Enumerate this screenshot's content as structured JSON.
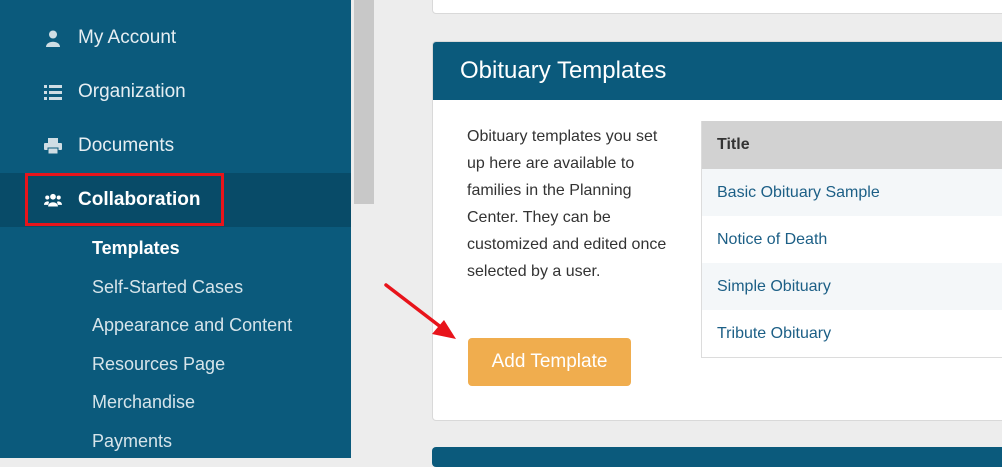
{
  "sidebar": {
    "items": [
      {
        "label": "My Account",
        "icon": "user-icon"
      },
      {
        "label": "Organization",
        "icon": "list-icon"
      },
      {
        "label": "Documents",
        "icon": "printer-icon"
      },
      {
        "label": "Collaboration",
        "icon": "users-icon"
      }
    ],
    "subitems": [
      {
        "label": "Templates"
      },
      {
        "label": "Self-Started Cases"
      },
      {
        "label": "Appearance and Content"
      },
      {
        "label": "Resources Page"
      },
      {
        "label": "Merchandise"
      },
      {
        "label": "Payments"
      }
    ]
  },
  "card": {
    "title": "Obituary Templates",
    "description": "Obituary templates you set up here are available to families in the Planning Center. They can be customized and edited once selected by a user.",
    "add_button": "Add Template"
  },
  "table": {
    "header": "Title",
    "rows": [
      "Basic Obituary Sample",
      "Notice of Death",
      "Simple Obituary",
      "Tribute Obituary"
    ]
  },
  "colors": {
    "sidebar": "#0b5a7c",
    "button": "#f0ad4e",
    "highlight": "#e8141b",
    "link": "#1c5f86"
  }
}
